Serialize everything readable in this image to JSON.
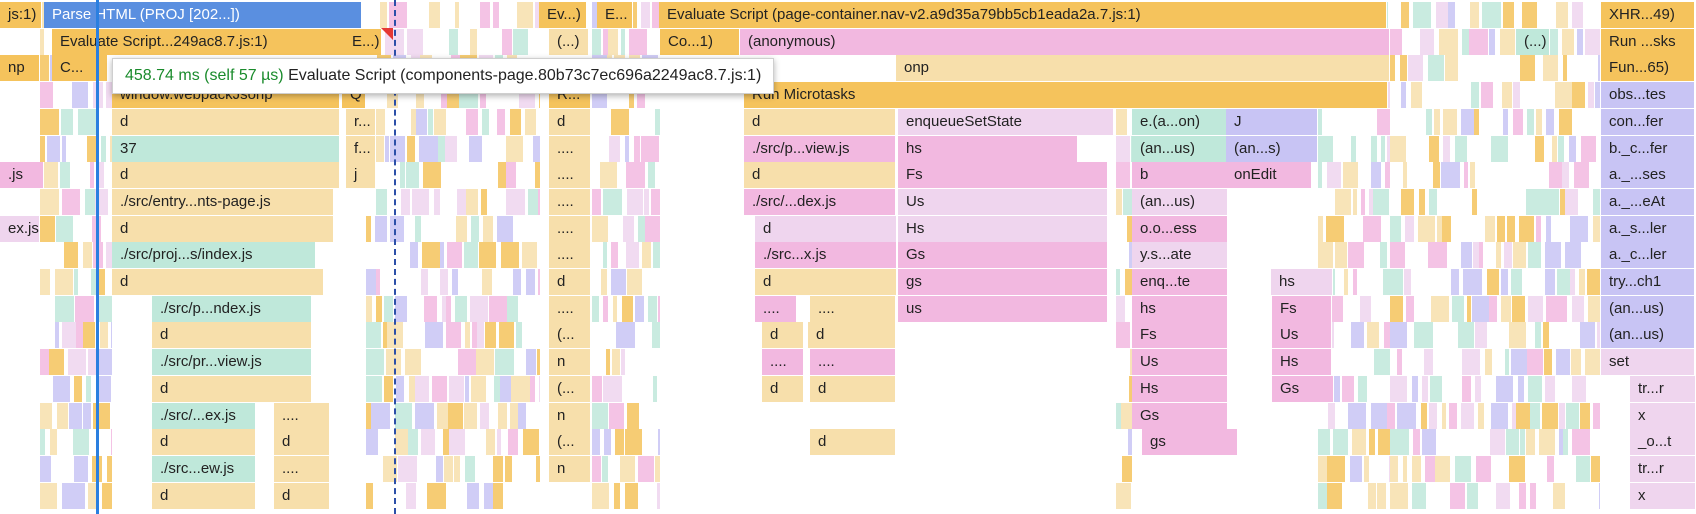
{
  "tooltip": {
    "time": "458.74 ms (self 57 µs)",
    "label": "Evaluate Script (components-page.80b73c7ec696a2249ac8.7.js:1)"
  },
  "colors": {
    "yellow": "#f5c35c",
    "tan": "#f7dfab",
    "pink": "#f2b8e0",
    "pink_light": "#efd5ee",
    "purple": "#c8c4f4",
    "teal": "#bfe8da",
    "blue_selected": "#5a8fe0",
    "selection_line": "#2a7fe0",
    "dashed_line": "#2c4fa8"
  },
  "blocks": [
    {
      "name": "js-1",
      "text": "js:1)"
    },
    {
      "name": "parse-html",
      "text": "Parse HTML (PROJ [202...])"
    },
    {
      "name": "evaluate-script-trunc-1",
      "text": "Ev...)"
    },
    {
      "name": "evaluate-script-trunc-2",
      "text": "E..."
    },
    {
      "name": "evaluate-script-page-container",
      "text": "Evaluate Script (page-container.nav-v2.a9d35a79bb5cb1eada2a.7.js:1)"
    },
    {
      "name": "xhr",
      "text": "XHR...49)"
    },
    {
      "name": "evaluate-script-components",
      "text": "Evaluate Script...249ac8.7.js:1)"
    },
    {
      "name": "e-trunc",
      "text": "E...)"
    },
    {
      "name": "ellipsis-paren-1",
      "text": "(...)"
    },
    {
      "name": "co-1",
      "text": "Co...1)"
    },
    {
      "name": "anonymous-1",
      "text": "(anonymous)"
    },
    {
      "name": "ellipsis-paren-2",
      "text": "(...)"
    },
    {
      "name": "run-sks",
      "text": "Run ...sks"
    },
    {
      "name": "np",
      "text": "np"
    },
    {
      "name": "c-trunc",
      "text": "C..."
    },
    {
      "name": "onp",
      "text": "onp"
    },
    {
      "name": "fun-65",
      "text": "Fun...65)"
    },
    {
      "name": "window-webpackjsonp",
      "text": "window.webpackJsonp"
    },
    {
      "name": "q",
      "text": "Q"
    },
    {
      "name": "r-trunc-1",
      "text": "R..."
    },
    {
      "name": "run-microtasks",
      "text": "Run Microtasks"
    },
    {
      "name": "obs-tes",
      "text": "obs...tes"
    },
    {
      "name": "d-1",
      "text": "d"
    },
    {
      "name": "r-trunc-2",
      "text": "r..."
    },
    {
      "name": "d-2",
      "text": "d"
    },
    {
      "name": "d-3",
      "text": "d"
    },
    {
      "name": "enqueuesetstate",
      "text": "enqueueSetState"
    },
    {
      "name": "e-a-on",
      "text": "e.(a...on)"
    },
    {
      "name": "j",
      "text": "J"
    },
    {
      "name": "con-fer",
      "text": "con...fer"
    },
    {
      "name": "n-37",
      "text": "37"
    },
    {
      "name": "f-trunc",
      "text": "f..."
    },
    {
      "name": "dots-1",
      "text": "...."
    },
    {
      "name": "src-p-view",
      "text": "./src/p...view.js"
    },
    {
      "name": "hs-1",
      "text": "hs"
    },
    {
      "name": "an-us-1",
      "text": "(an...us)"
    },
    {
      "name": "an-s",
      "text": "(an...s)"
    },
    {
      "name": "b-c-fer",
      "text": "b._c...fer"
    },
    {
      "name": "s-js",
      "text": ".js"
    },
    {
      "name": "d-4",
      "text": "d"
    },
    {
      "name": "j-small",
      "text": "j"
    },
    {
      "name": "dots-2",
      "text": "...."
    },
    {
      "name": "d-5",
      "text": "d"
    },
    {
      "name": "fs-1",
      "text": "Fs"
    },
    {
      "name": "b",
      "text": "b"
    },
    {
      "name": "onedit",
      "text": "onEdit"
    },
    {
      "name": "a-ses",
      "text": "a._...ses"
    },
    {
      "name": "src-entry",
      "text": "./src/entry...nts-page.js"
    },
    {
      "name": "dots-3",
      "text": "...."
    },
    {
      "name": "src-dex-1",
      "text": "./src/...dex.js"
    },
    {
      "name": "us-1",
      "text": "Us"
    },
    {
      "name": "an-us-2",
      "text": "(an...us)"
    },
    {
      "name": "a-eat",
      "text": "a._...eAt"
    },
    {
      "name": "ex-js",
      "text": "ex.js"
    },
    {
      "name": "d-6",
      "text": "d"
    },
    {
      "name": "dots-4",
      "text": "...."
    },
    {
      "name": "d-7",
      "text": "d"
    },
    {
      "name": "hs-2",
      "text": "Hs"
    },
    {
      "name": "o-o-ess",
      "text": "o.o...ess"
    },
    {
      "name": "a-s-ler",
      "text": "a._s...ler"
    },
    {
      "name": "src-proj-index",
      "text": "./src/proj...s/index.js"
    },
    {
      "name": "dots-5",
      "text": "...."
    },
    {
      "name": "src-x-js",
      "text": "./src...x.js"
    },
    {
      "name": "gs-1",
      "text": "Gs"
    },
    {
      "name": "y-s-ate",
      "text": "y.s...ate"
    },
    {
      "name": "a-c-ler",
      "text": "a._c...ler"
    },
    {
      "name": "d-8",
      "text": "d"
    },
    {
      "name": "d-9",
      "text": "d"
    },
    {
      "name": "d-10",
      "text": "d"
    },
    {
      "name": "gs-2",
      "text": "gs"
    },
    {
      "name": "enq-te",
      "text": "enq...te"
    },
    {
      "name": "hs-3",
      "text": "hs"
    },
    {
      "name": "try-ch1",
      "text": "try...ch1"
    },
    {
      "name": "src-p-ndex",
      "text": "./src/p...ndex.js"
    },
    {
      "name": "dots-6",
      "text": "...."
    },
    {
      "name": "dots-7",
      "text": "...."
    },
    {
      "name": "dots-8",
      "text": "...."
    },
    {
      "name": "us-2",
      "text": "us"
    },
    {
      "name": "hs-4",
      "text": "hs"
    },
    {
      "name": "fs-2",
      "text": "Fs"
    },
    {
      "name": "an-us-3",
      "text": "(an...us)"
    },
    {
      "name": "d-11",
      "text": "d"
    },
    {
      "name": "paren-1",
      "text": "(..."
    },
    {
      "name": "d-12",
      "text": "d"
    },
    {
      "name": "d-13",
      "text": "d"
    },
    {
      "name": "fs-3",
      "text": "Fs"
    },
    {
      "name": "us-3",
      "text": "Us"
    },
    {
      "name": "an-us-4",
      "text": "(an...us)"
    },
    {
      "name": "src-pr-view",
      "text": "./src/pr...view.js"
    },
    {
      "name": "n-1",
      "text": "n"
    },
    {
      "name": "dots-9",
      "text": "...."
    },
    {
      "name": "dots-10",
      "text": "...."
    },
    {
      "name": "us-4",
      "text": "Us"
    },
    {
      "name": "hs-5",
      "text": "Hs"
    },
    {
      "name": "set",
      "text": "set"
    },
    {
      "name": "d-14",
      "text": "d"
    },
    {
      "name": "paren-2",
      "text": "(..."
    },
    {
      "name": "d-15",
      "text": "d"
    },
    {
      "name": "d-16",
      "text": "d"
    },
    {
      "name": "hs-6",
      "text": "Hs"
    },
    {
      "name": "gs-3",
      "text": "Gs"
    },
    {
      "name": "tr-r-1",
      "text": "tr...r"
    },
    {
      "name": "src-ex-js",
      "text": "./src/...ex.js"
    },
    {
      "name": "dots-11",
      "text": "...."
    },
    {
      "name": "n-2",
      "text": "n"
    },
    {
      "name": "gs-4",
      "text": "Gs"
    },
    {
      "name": "x-1",
      "text": "x"
    },
    {
      "name": "d-17",
      "text": "d"
    },
    {
      "name": "d-18",
      "text": "d"
    },
    {
      "name": "paren-3",
      "text": "(..."
    },
    {
      "name": "d-19",
      "text": "d"
    },
    {
      "name": "gs-5",
      "text": "gs"
    },
    {
      "name": "o-t",
      "text": "_o...t"
    },
    {
      "name": "src-ew-js",
      "text": "./src...ew.js"
    },
    {
      "name": "dots-12",
      "text": "...."
    },
    {
      "name": "n-3",
      "text": "n"
    },
    {
      "name": "tr-r-2",
      "text": "tr...r"
    },
    {
      "name": "d-20",
      "text": "d"
    },
    {
      "name": "d-21",
      "text": "d"
    },
    {
      "name": "x-2",
      "text": "x"
    }
  ]
}
